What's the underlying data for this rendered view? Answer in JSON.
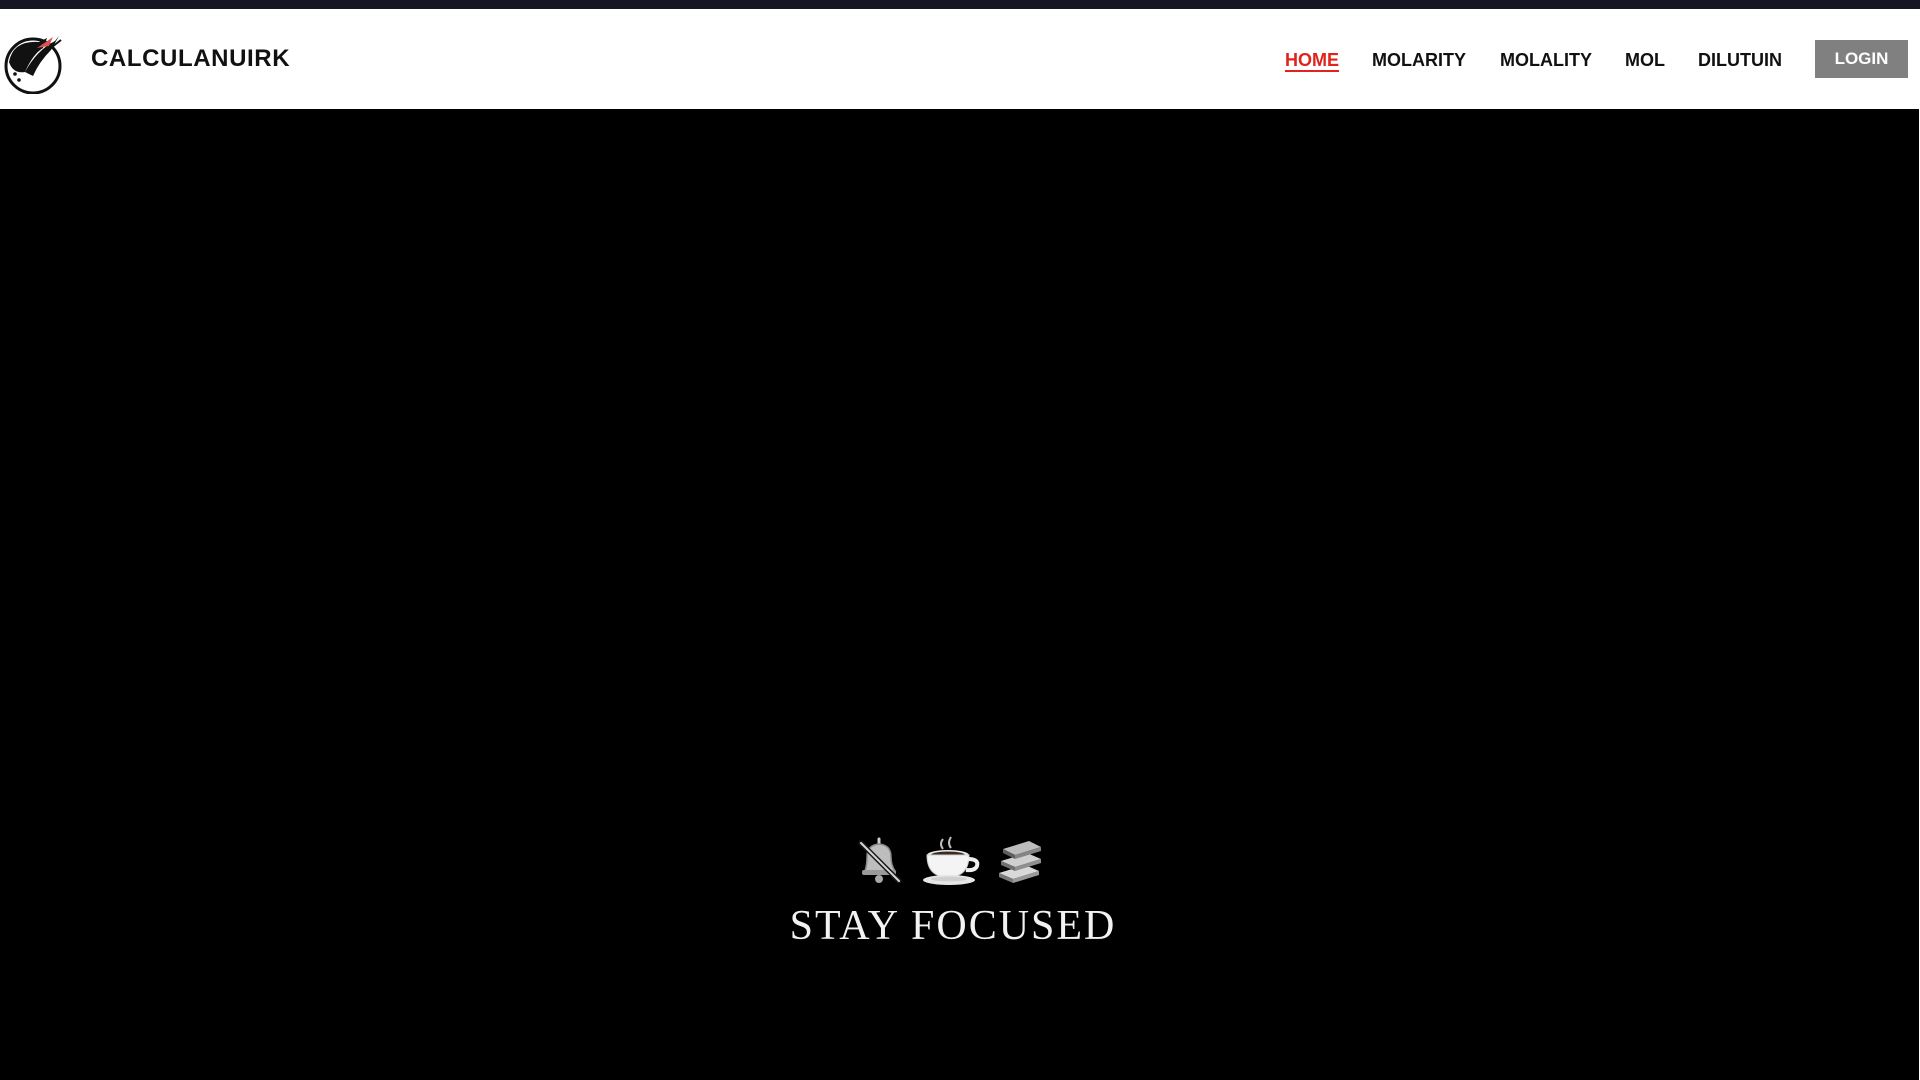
{
  "header": {
    "brand": "CALCULANUIRK",
    "logo_icon": "ninja-bird-logo-icon"
  },
  "nav": {
    "items": [
      {
        "label": "HOME",
        "active": true
      },
      {
        "label": "MOLARITY",
        "active": false
      },
      {
        "label": "MOLALITY",
        "active": false
      },
      {
        "label": "MOL",
        "active": false
      },
      {
        "label": "DILUTUIN",
        "active": false
      }
    ],
    "login_label": "LOGIN"
  },
  "hero": {
    "icons": [
      "muted-bell-icon",
      "coffee-cup-icon",
      "books-icon"
    ],
    "title": "STAY FOCUSED"
  },
  "colors": {
    "top_strip": "#161622",
    "active_nav": "#e0241c",
    "login_bg": "#808080",
    "hero_bg": "#000000"
  }
}
